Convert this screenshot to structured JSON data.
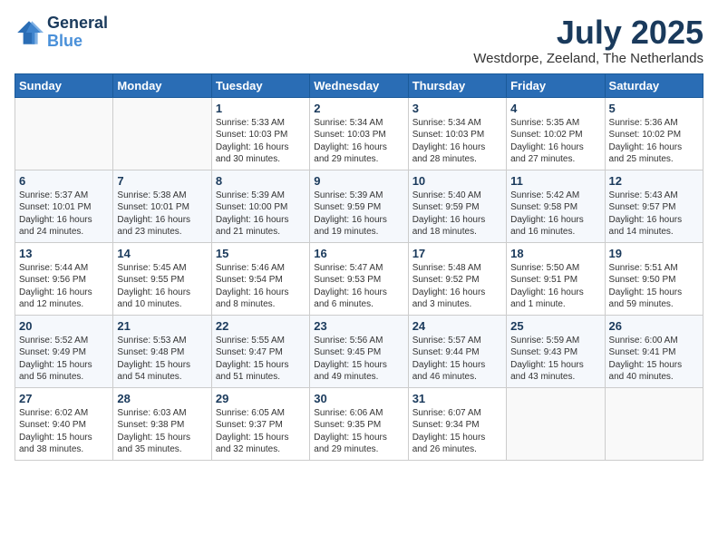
{
  "header": {
    "logo_line1": "General",
    "logo_line2": "Blue",
    "month_title": "July 2025",
    "location": "Westdorpe, Zeeland, The Netherlands"
  },
  "days_of_week": [
    "Sunday",
    "Monday",
    "Tuesday",
    "Wednesday",
    "Thursday",
    "Friday",
    "Saturday"
  ],
  "weeks": [
    [
      {
        "day": "",
        "content": ""
      },
      {
        "day": "",
        "content": ""
      },
      {
        "day": "1",
        "content": "Sunrise: 5:33 AM\nSunset: 10:03 PM\nDaylight: 16 hours\nand 30 minutes."
      },
      {
        "day": "2",
        "content": "Sunrise: 5:34 AM\nSunset: 10:03 PM\nDaylight: 16 hours\nand 29 minutes."
      },
      {
        "day": "3",
        "content": "Sunrise: 5:34 AM\nSunset: 10:03 PM\nDaylight: 16 hours\nand 28 minutes."
      },
      {
        "day": "4",
        "content": "Sunrise: 5:35 AM\nSunset: 10:02 PM\nDaylight: 16 hours\nand 27 minutes."
      },
      {
        "day": "5",
        "content": "Sunrise: 5:36 AM\nSunset: 10:02 PM\nDaylight: 16 hours\nand 25 minutes."
      }
    ],
    [
      {
        "day": "6",
        "content": "Sunrise: 5:37 AM\nSunset: 10:01 PM\nDaylight: 16 hours\nand 24 minutes."
      },
      {
        "day": "7",
        "content": "Sunrise: 5:38 AM\nSunset: 10:01 PM\nDaylight: 16 hours\nand 23 minutes."
      },
      {
        "day": "8",
        "content": "Sunrise: 5:39 AM\nSunset: 10:00 PM\nDaylight: 16 hours\nand 21 minutes."
      },
      {
        "day": "9",
        "content": "Sunrise: 5:39 AM\nSunset: 9:59 PM\nDaylight: 16 hours\nand 19 minutes."
      },
      {
        "day": "10",
        "content": "Sunrise: 5:40 AM\nSunset: 9:59 PM\nDaylight: 16 hours\nand 18 minutes."
      },
      {
        "day": "11",
        "content": "Sunrise: 5:42 AM\nSunset: 9:58 PM\nDaylight: 16 hours\nand 16 minutes."
      },
      {
        "day": "12",
        "content": "Sunrise: 5:43 AM\nSunset: 9:57 PM\nDaylight: 16 hours\nand 14 minutes."
      }
    ],
    [
      {
        "day": "13",
        "content": "Sunrise: 5:44 AM\nSunset: 9:56 PM\nDaylight: 16 hours\nand 12 minutes."
      },
      {
        "day": "14",
        "content": "Sunrise: 5:45 AM\nSunset: 9:55 PM\nDaylight: 16 hours\nand 10 minutes."
      },
      {
        "day": "15",
        "content": "Sunrise: 5:46 AM\nSunset: 9:54 PM\nDaylight: 16 hours\nand 8 minutes."
      },
      {
        "day": "16",
        "content": "Sunrise: 5:47 AM\nSunset: 9:53 PM\nDaylight: 16 hours\nand 6 minutes."
      },
      {
        "day": "17",
        "content": "Sunrise: 5:48 AM\nSunset: 9:52 PM\nDaylight: 16 hours\nand 3 minutes."
      },
      {
        "day": "18",
        "content": "Sunrise: 5:50 AM\nSunset: 9:51 PM\nDaylight: 16 hours\nand 1 minute."
      },
      {
        "day": "19",
        "content": "Sunrise: 5:51 AM\nSunset: 9:50 PM\nDaylight: 15 hours\nand 59 minutes."
      }
    ],
    [
      {
        "day": "20",
        "content": "Sunrise: 5:52 AM\nSunset: 9:49 PM\nDaylight: 15 hours\nand 56 minutes."
      },
      {
        "day": "21",
        "content": "Sunrise: 5:53 AM\nSunset: 9:48 PM\nDaylight: 15 hours\nand 54 minutes."
      },
      {
        "day": "22",
        "content": "Sunrise: 5:55 AM\nSunset: 9:47 PM\nDaylight: 15 hours\nand 51 minutes."
      },
      {
        "day": "23",
        "content": "Sunrise: 5:56 AM\nSunset: 9:45 PM\nDaylight: 15 hours\nand 49 minutes."
      },
      {
        "day": "24",
        "content": "Sunrise: 5:57 AM\nSunset: 9:44 PM\nDaylight: 15 hours\nand 46 minutes."
      },
      {
        "day": "25",
        "content": "Sunrise: 5:59 AM\nSunset: 9:43 PM\nDaylight: 15 hours\nand 43 minutes."
      },
      {
        "day": "26",
        "content": "Sunrise: 6:00 AM\nSunset: 9:41 PM\nDaylight: 15 hours\nand 40 minutes."
      }
    ],
    [
      {
        "day": "27",
        "content": "Sunrise: 6:02 AM\nSunset: 9:40 PM\nDaylight: 15 hours\nand 38 minutes."
      },
      {
        "day": "28",
        "content": "Sunrise: 6:03 AM\nSunset: 9:38 PM\nDaylight: 15 hours\nand 35 minutes."
      },
      {
        "day": "29",
        "content": "Sunrise: 6:05 AM\nSunset: 9:37 PM\nDaylight: 15 hours\nand 32 minutes."
      },
      {
        "day": "30",
        "content": "Sunrise: 6:06 AM\nSunset: 9:35 PM\nDaylight: 15 hours\nand 29 minutes."
      },
      {
        "day": "31",
        "content": "Sunrise: 6:07 AM\nSunset: 9:34 PM\nDaylight: 15 hours\nand 26 minutes."
      },
      {
        "day": "",
        "content": ""
      },
      {
        "day": "",
        "content": ""
      }
    ]
  ]
}
